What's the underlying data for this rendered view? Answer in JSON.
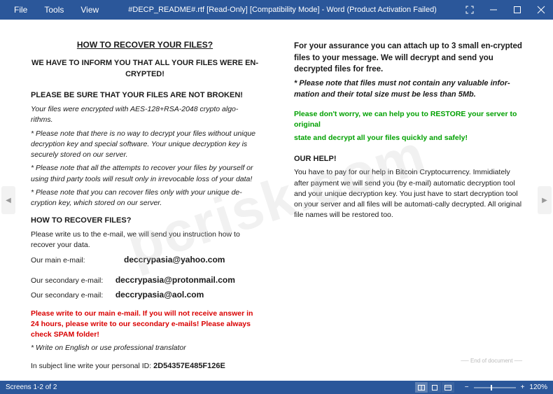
{
  "titlebar": {
    "menus": [
      "File",
      "Tools",
      "View"
    ],
    "title": "#DECP_README#.rtf [Read-Only] [Compatibility Mode] - Word (Product Activation Failed)"
  },
  "doc": {
    "heading": "HOW TO RECOVER YOUR FILES?",
    "subheading": "WE HAVE TO INFORM YOU THAT ALL YOUR FILES WERE EN-CRYPTED!",
    "warn_title": "PLEASE BE SURE THAT YOUR FILES ARE NOT BROKEN!",
    "encrypted_line": "Your files were encrypted with AES-128+RSA-2048 crypto algo-rithms.",
    "note1": "* Please note that there is no way to decrypt your files without unique decryption key and special software. Your unique decryption key is securely stored on our server.",
    "note2": "* Please note that all the attempts to recover your files by yourself or using third party tools will result only in irrevocable loss of your data!",
    "note3": "* Please note that you can recover files only with your unique de-cryption key, which stored on our server.",
    "how_title": "HOW TO RECOVER FILES?",
    "how_body": "Please write us to the e-mail, we will send you instruction how to recover your data.",
    "main_label": "Our main e-mail:",
    "main_email": "deccrypasia@yahoo.com",
    "sec_label1": "Our secondary e-mail:",
    "sec_email1": "deccrypasia@protonmail.com",
    "sec_label2": "Our secondary e-mail:",
    "sec_email2": "deccrypasia@aol.com",
    "red_warn": "Please write to our main e-mail. If you will not receive answer in 24 hours, please write to our secondary e-mails! Please always check SPAM folder!",
    "translator": "* Write on English or use professional translator",
    "subject_line": "In subject line write your personal ID: ",
    "personal_id": "2D54357E485F126E",
    "assurance": "For your assurance you can attach up to 3 small en-crypted files to your message. We will decrypt and send you decrypted files for free.",
    "assurance_note": "*       Please note that files must not contain any valuable infor-mation and their total size must be less than 5Mb.",
    "green1": "Please don't worry, we can help you to RESTORE your server to original",
    "green2": "state and decrypt all your files quickly and safely!",
    "ourhelp_title": "OUR HELP!",
    "ourhelp_body": "You have to pay for our help in Bitcoin Cryptocurrency. Immidiately after payment we will send you (by e-mail) automatic decryption tool and your unique decryption key. You just have to start decryption tool on your server and all files will be automati-cally decrypted. All original file names will be restored too.",
    "eod": "End of document"
  },
  "status": {
    "screens": "Screens 1-2 of 2",
    "zoom_minus": "−",
    "zoom_plus": "+",
    "zoom_pct": "120%"
  },
  "watermark": "pcrisk.com"
}
